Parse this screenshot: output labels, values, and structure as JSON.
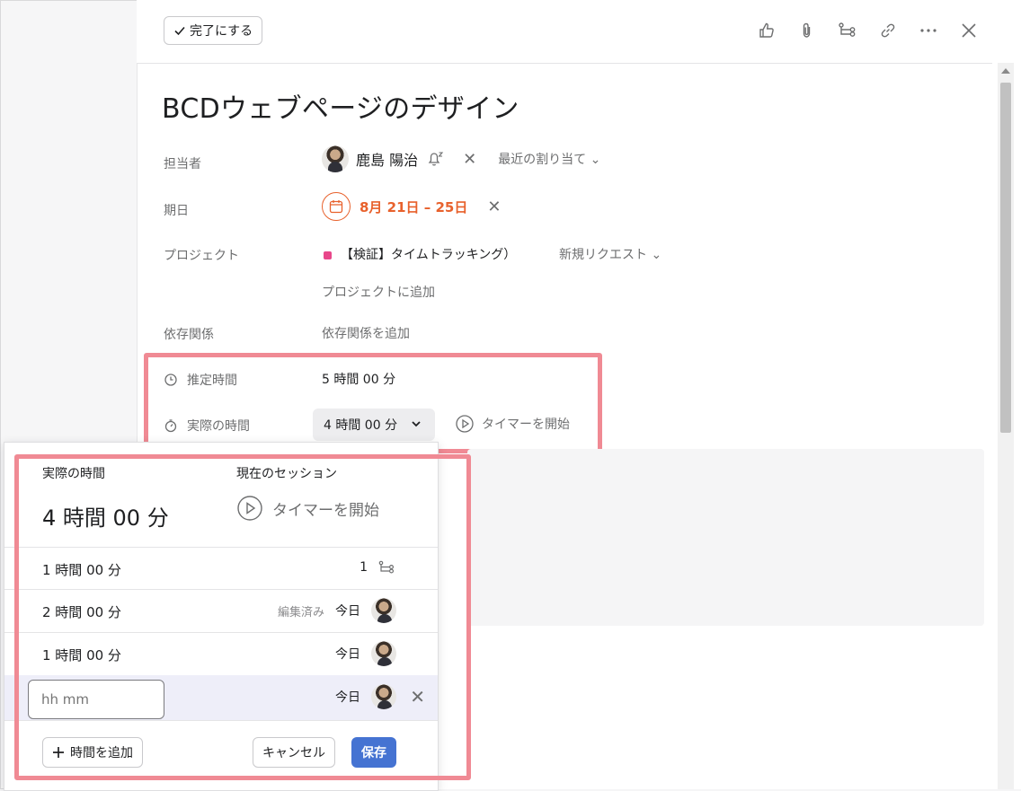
{
  "toolbar": {
    "complete_label": "完了にする"
  },
  "task": {
    "title": "BCDウェブページのデザイン"
  },
  "fields": {
    "assignee_label": "担当者",
    "assignee_name": "鹿島 陽治",
    "recent_assign": "最近の割り当て",
    "due_label": "期日",
    "due_value": "8月 21日 – 25日",
    "project_label": "プロジェクト",
    "project_name": "【検証】タイムトラッキング）",
    "project_section": "新規リクエスト",
    "add_project": "プロジェクトに追加",
    "deps_label": "依存関係",
    "add_deps": "依存関係を追加",
    "estimate_label": "推定時間",
    "estimate_value": "5 時間 00 分",
    "actual_label": "実際の時間",
    "actual_value": "4 時間 00 分",
    "start_timer": "タイマーを開始"
  },
  "popup": {
    "actual_header": "実際の時間",
    "actual_total": "4 時間 00 分",
    "session_header": "現在のセッション",
    "start_timer": "タイマーを開始",
    "entries": [
      {
        "time": "1 時間 00 分",
        "subtask_count": "1"
      },
      {
        "time": "2 時間 00 分",
        "edited": "編集済み",
        "date": "今日"
      },
      {
        "time": "1 時間 00 分",
        "date": "今日"
      }
    ],
    "input_placeholder": "hh mm",
    "input_date": "今日",
    "add_time": "時間を追加",
    "cancel": "キャンセル",
    "save": "保存"
  },
  "colors": {
    "accent_blue": "#4573d2",
    "due_orange": "#e8612c",
    "project_pink": "#e8478a",
    "highlight": "#f08a94"
  }
}
